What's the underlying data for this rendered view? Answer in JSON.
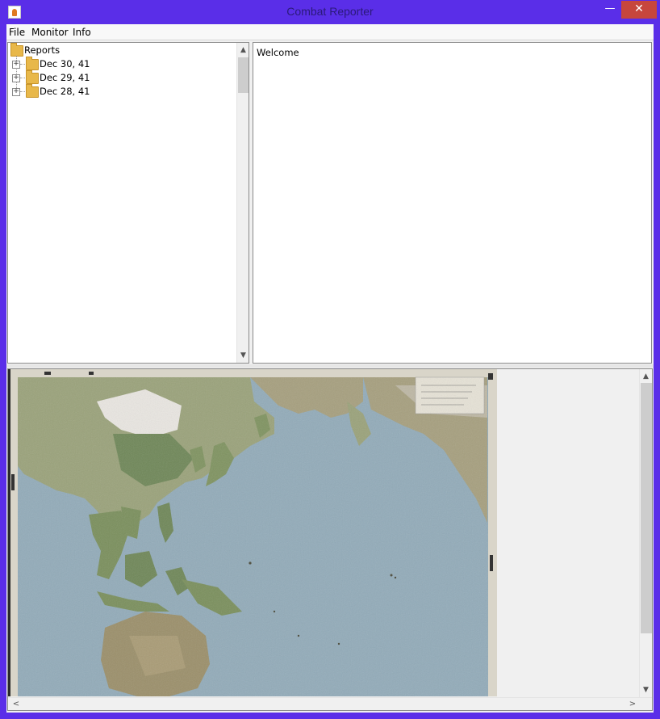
{
  "window": {
    "title": "Combat Reporter",
    "icon": "java-cup-icon",
    "controls": {
      "minimize": "—",
      "maximize": "☐",
      "close": "✕"
    }
  },
  "menubar": {
    "items": [
      {
        "label": "File"
      },
      {
        "label": "Monitor"
      },
      {
        "label": "Info"
      }
    ]
  },
  "tree": {
    "root": {
      "label": "Reports"
    },
    "nodes": [
      {
        "label": "Dec 30, 41"
      },
      {
        "label": "Dec 29, 41"
      },
      {
        "label": "Dec 28, 41"
      }
    ]
  },
  "content": {
    "text": "Welcome"
  },
  "map": {
    "icon": "pacific-theater-map",
    "colors": {
      "ocean": "#8da9b8",
      "land": "#9aa27a",
      "land_dark": "#6f8758",
      "snow": "#e9e6e1",
      "frame": "#1d1d1d"
    }
  },
  "scroll": {
    "up": "▲",
    "down": "▼",
    "left": "<",
    "right": ">"
  }
}
